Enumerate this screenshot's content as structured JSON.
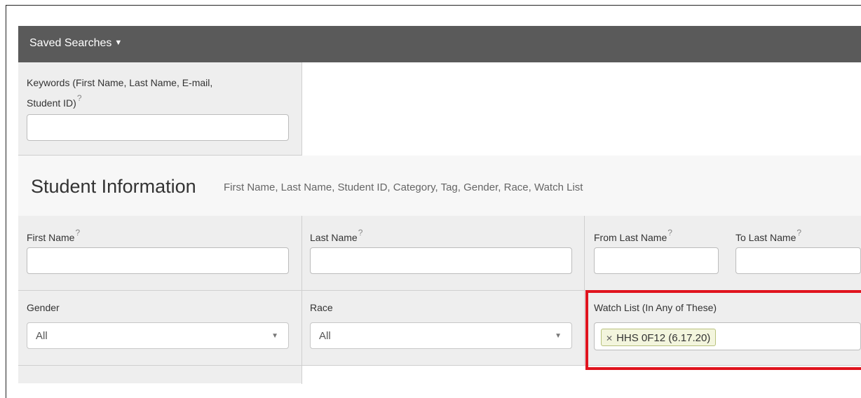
{
  "header": {
    "saved_searches": "Saved Searches"
  },
  "keywords": {
    "label": "Keywords (First Name, Last Name, E-mail,",
    "label2": "Student ID)",
    "help": "?",
    "value": ""
  },
  "section": {
    "title": "Student Information",
    "subtitle": "First Name, Last Name, Student ID, Category, Tag, Gender, Race, Watch List"
  },
  "fields": {
    "first_name": {
      "label": "First Name",
      "help": "?",
      "value": ""
    },
    "last_name": {
      "label": "Last Name",
      "help": "?",
      "value": ""
    },
    "from_last_name": {
      "label": "From Last Name",
      "help": "?",
      "value": ""
    },
    "to_last_name": {
      "label": "To Last Name",
      "help": "?",
      "value": ""
    },
    "gender": {
      "label": "Gender",
      "selected": "All"
    },
    "race": {
      "label": "Race",
      "selected": "All"
    },
    "watch_list": {
      "label": "Watch List (In Any of These)",
      "tags": [
        "HHS 0F12 (6.17.20)"
      ]
    }
  },
  "colors": {
    "highlight": "#e0141e",
    "topbar": "#5a5a5a"
  }
}
